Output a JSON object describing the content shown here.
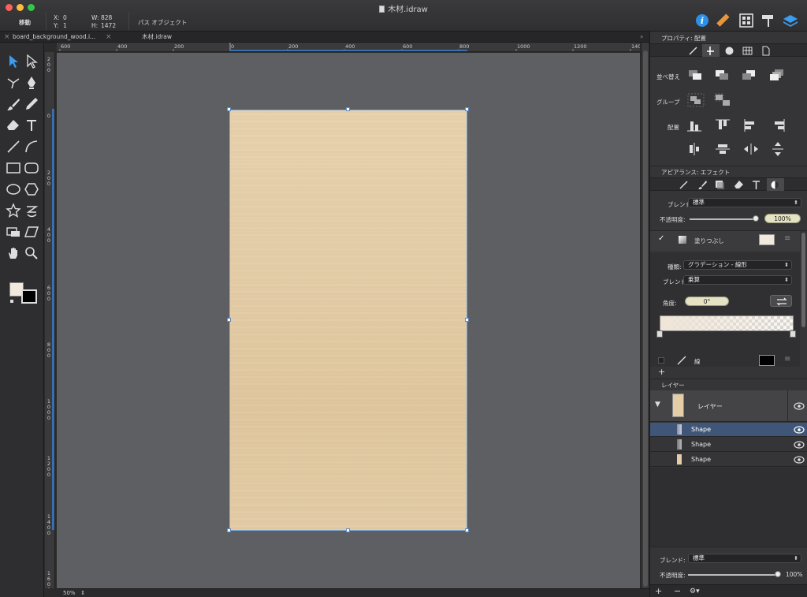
{
  "window": {
    "title": "木材.idraw"
  },
  "toolbar": {
    "tool_name": "移動",
    "x_label": "X:",
    "x_value": "0",
    "y_label": "Y:",
    "y_value": "1",
    "w_label": "W:",
    "w_value": "828",
    "h_label": "H:",
    "h_value": "1472",
    "selection_kind": "パス オブジェクト"
  },
  "tabs": [
    {
      "label": "board_background_wood.i..."
    },
    {
      "label": "木材.idraw"
    }
  ],
  "rulers": {
    "h_labels": [
      "600",
      "400",
      "200",
      "0",
      "200",
      "400",
      "600",
      "800",
      "1000",
      "1200",
      "1400"
    ],
    "v_labels": [
      "200",
      "0",
      "200",
      "400",
      "600",
      "800",
      "1000",
      "1200",
      "1400",
      "1600"
    ]
  },
  "canvas": {
    "zoom": "50%",
    "zoom_arrows": "⇕"
  },
  "inspector": {
    "properties_title": "プロパティ: 配置",
    "arrange_label": "並べ替え",
    "group_label": "グループ",
    "align_label": "配置",
    "appearance_title": "アピアランス: エフェクト",
    "blend_label": "ブレンド",
    "blend_value": "標準",
    "opacity_label": "不透明度:",
    "opacity_value": "100%",
    "fill_label": "塗りつぶし",
    "fill_color": "#f1e9dd",
    "type_label": "種類:",
    "type_value": "グラデーション - 線形",
    "fill_blend_label": "ブレンド",
    "fill_blend_value": "乗算",
    "angle_label": "角度:",
    "angle_value": "0°",
    "stroke_label": "線",
    "stroke_color": "#000000",
    "add_effect": "+"
  },
  "layers": {
    "title": "レイヤー",
    "root_name": "レイヤー",
    "items": [
      {
        "name": "Shape",
        "selected": true
      },
      {
        "name": "Shape",
        "selected": false
      },
      {
        "name": "Shape",
        "selected": false
      }
    ],
    "blend_label": "ブレンド:",
    "blend_value": "標準",
    "opacity_label": "不透明度:",
    "opacity_value": "100%",
    "add": "+",
    "remove": "−"
  },
  "colors": {
    "accent": "#4a9fe8",
    "selection_row": "#3f5679",
    "wood": "#e4cda7",
    "canvas_bg": "#5d5f62"
  }
}
